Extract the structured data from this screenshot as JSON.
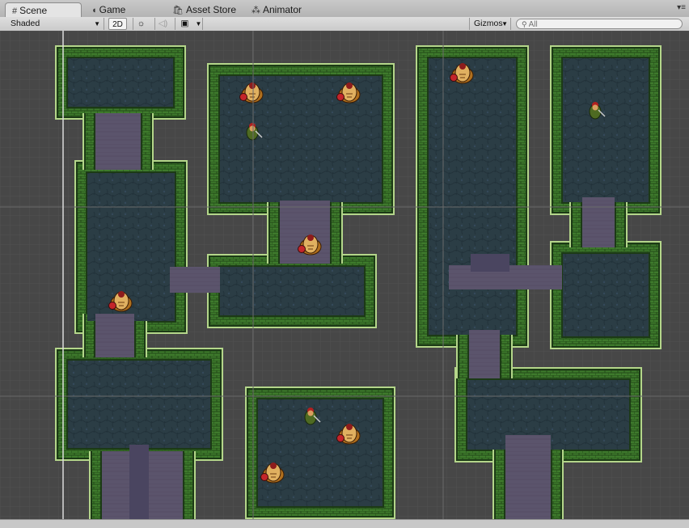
{
  "tabs": [
    {
      "label": "Scene",
      "icon": "grid-icon",
      "active": true
    },
    {
      "label": "Game",
      "icon": "pacman-icon",
      "active": false
    },
    {
      "label": "Asset Store",
      "icon": "shopping-bag-icon",
      "active": false
    },
    {
      "label": "Animator",
      "icon": "animator-icon",
      "active": false
    }
  ],
  "toolbar": {
    "shading_mode": "Shaded",
    "mode_2d": "2D",
    "lighting_icon": "sun-icon",
    "audio_icon": "speaker-icon",
    "effects_icon": "image-icon",
    "gizmos_label": "Gizmos",
    "search_placeholder": "All"
  },
  "colors": {
    "scene_bg": "#474747",
    "grid_line": "#5e5e5e",
    "floor": "#2a3c44",
    "wall_dark": "#1c3a16",
    "wall_mid": "#3f7a2c",
    "wall_light": "#b4d68a",
    "corridor": "#5c556e",
    "axis_line": "#d8d8d8"
  },
  "scene": {
    "rooms": [
      {
        "name": "room-top-left-small"
      },
      {
        "name": "room-left-tall"
      },
      {
        "name": "room-center-top"
      },
      {
        "name": "room-center-right"
      },
      {
        "name": "room-bottom-left"
      },
      {
        "name": "room-bottom-center"
      },
      {
        "name": "room-right-tall"
      },
      {
        "name": "room-far-right-top"
      },
      {
        "name": "room-far-right-mid"
      },
      {
        "name": "room-bottom-right"
      }
    ],
    "characters": [
      {
        "name": "ogre-enemy",
        "kind": "ogre"
      },
      {
        "name": "ogre-enemy",
        "kind": "ogre"
      },
      {
        "name": "goblin-enemy",
        "kind": "goblin"
      },
      {
        "name": "ogre-enemy",
        "kind": "ogre"
      },
      {
        "name": "ogre-enemy",
        "kind": "ogre"
      },
      {
        "name": "ogre-enemy",
        "kind": "ogre"
      },
      {
        "name": "goblin-enemy",
        "kind": "goblin"
      },
      {
        "name": "goblin-enemy",
        "kind": "goblin"
      },
      {
        "name": "ogre-enemy",
        "kind": "ogre"
      },
      {
        "name": "ogre-enemy",
        "kind": "ogre"
      }
    ]
  }
}
